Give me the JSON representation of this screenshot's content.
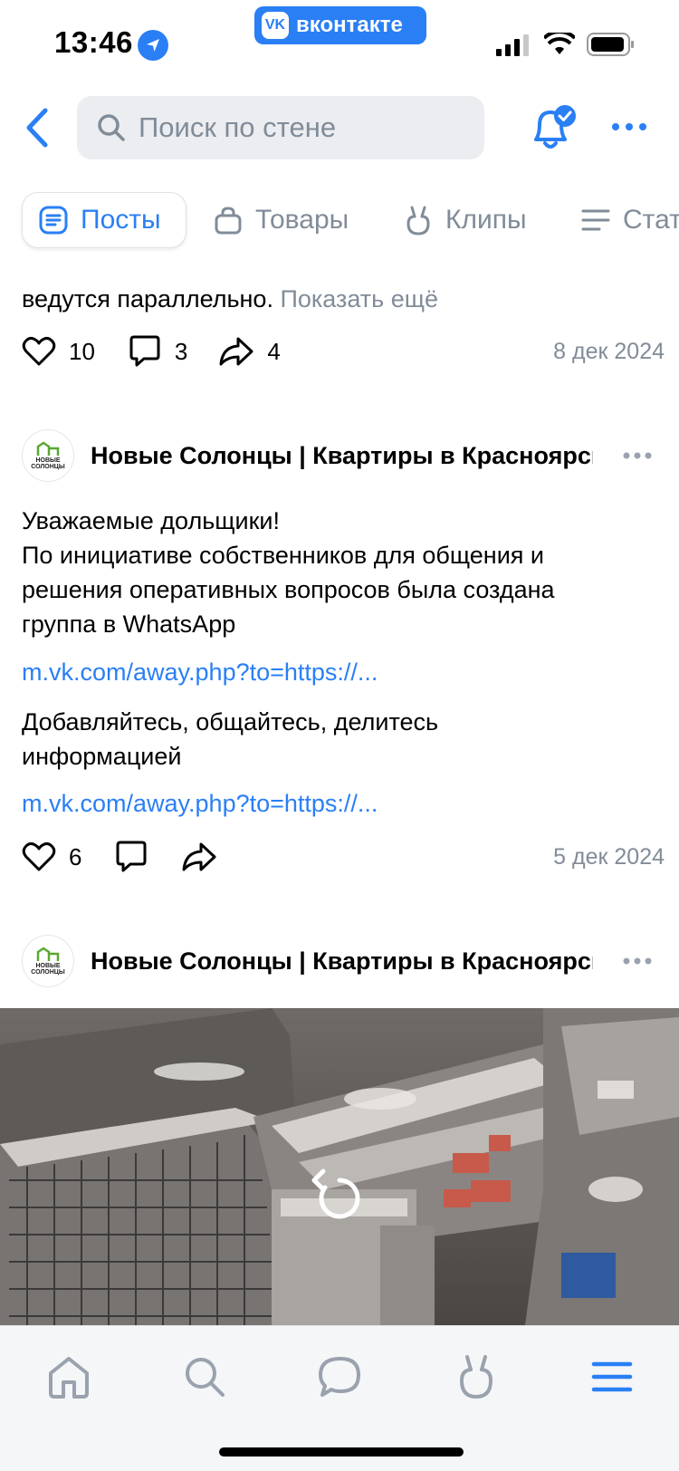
{
  "status_bar": {
    "time": "13:46",
    "app_label": "вконтакте"
  },
  "header": {
    "search_placeholder": "Поиск по стене"
  },
  "tabs": [
    {
      "label": "Посты",
      "icon": "posts-icon",
      "active": true
    },
    {
      "label": "Товары",
      "icon": "bag-icon",
      "active": false
    },
    {
      "label": "Клипы",
      "icon": "clips-icon",
      "active": false
    },
    {
      "label": "Статьи",
      "icon": "articles-icon",
      "active": false
    }
  ],
  "post1": {
    "text_tail": "ведутся параллельно.",
    "show_more": "Показать ещё",
    "likes": "10",
    "comments": "3",
    "reposts": "4",
    "date": "8 дек 2024"
  },
  "post2": {
    "author": "Новые Солонцы | Квартиры в Красноярске",
    "avatar_text": "НОВЫЕ СОЛОНЦЫ",
    "lines": [
      "Уважаемые дольщики!",
      "По инициативе собственников для общения и",
      "решения оперативных вопросов была создана",
      "группа в WhatsApp"
    ],
    "link1": "m.vk.com/away.php?to=https://...",
    "text2_lines": [
      "Добавляйтесь, общайтесь, делитесь",
      "информацией"
    ],
    "link2": "m.vk.com/away.php?to=https://...",
    "likes": "6",
    "date": "5 дек 2024"
  },
  "post3": {
    "author": "Новые Солонцы | Квартиры в Красноярске",
    "avatar_text": "НОВЫЕ СОЛОНЦЫ"
  },
  "bottom_nav": [
    "home-icon",
    "search-icon",
    "messages-icon",
    "clips-icon",
    "menu-icon"
  ],
  "colors": {
    "accent": "#2a7ff5",
    "secondary_text": "#818c99",
    "search_bg": "#ebedf0"
  }
}
